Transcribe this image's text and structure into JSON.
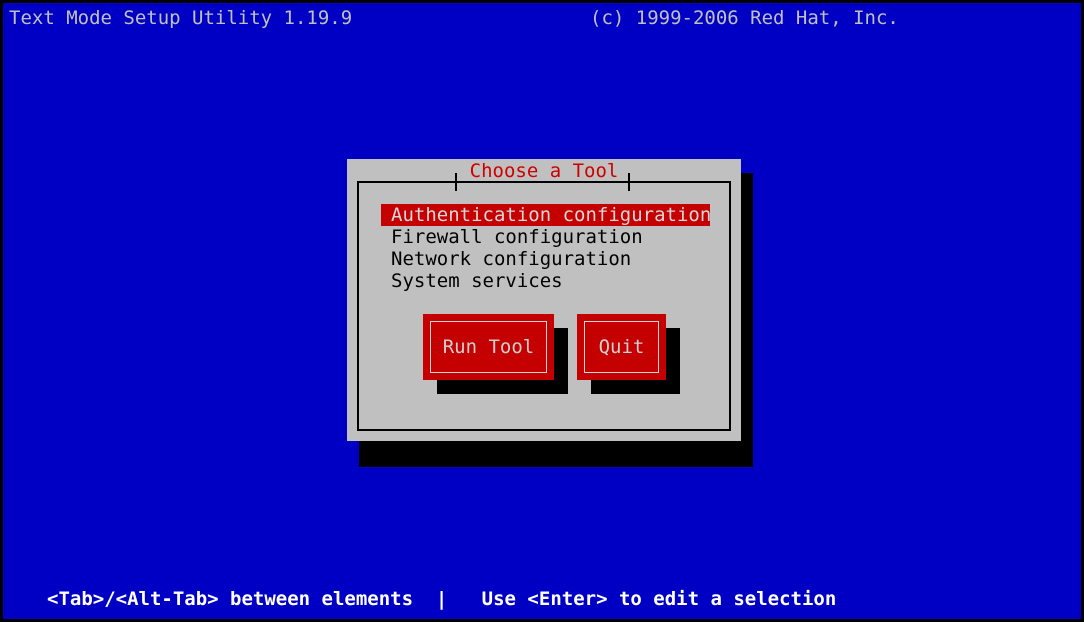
{
  "header": {
    "title": "Text Mode Setup Utility 1.19.9",
    "copyright": "(c) 1999-2006 Red Hat, Inc."
  },
  "dialog": {
    "title": "Choose a Tool",
    "list": [
      {
        "label": "Authentication configuration",
        "selected": true
      },
      {
        "label": "Firewall configuration",
        "selected": false
      },
      {
        "label": "Network configuration",
        "selected": false
      },
      {
        "label": "System services",
        "selected": false
      }
    ],
    "buttons": {
      "run": "Run Tool",
      "quit": "Quit"
    }
  },
  "footer": {
    "hint": "<Tab>/<Alt-Tab> between elements  |   Use <Enter> to edit a selection"
  },
  "colors": {
    "background": "#0000c4",
    "dialog_background": "#c0c0c0",
    "accent_red": "#c40000",
    "title_red": "#cc0000",
    "header_text": "#c0c0c0",
    "footer_text": "#ffffff",
    "shadow": "#000000"
  }
}
